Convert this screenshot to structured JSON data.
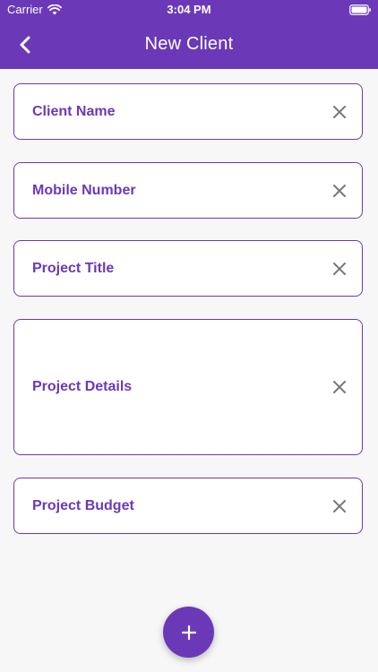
{
  "status_bar": {
    "carrier": "Carrier",
    "time": "3:04 PM"
  },
  "nav": {
    "title": "New Client",
    "back_icon": "chevron-left-icon"
  },
  "form": {
    "fields": [
      {
        "label": "Client Name",
        "clear_icon": "close-icon"
      },
      {
        "label": "Mobile Number",
        "clear_icon": "close-icon"
      },
      {
        "label": "Project Title",
        "clear_icon": "close-icon"
      },
      {
        "label": "Project Details",
        "clear_icon": "close-icon"
      },
      {
        "label": "Project Budget",
        "clear_icon": "close-icon"
      }
    ]
  },
  "fab": {
    "icon": "plus-icon"
  },
  "colors": {
    "primary": "#6b39b8",
    "background": "#f7f7f8",
    "clear_icon": "#777777"
  }
}
